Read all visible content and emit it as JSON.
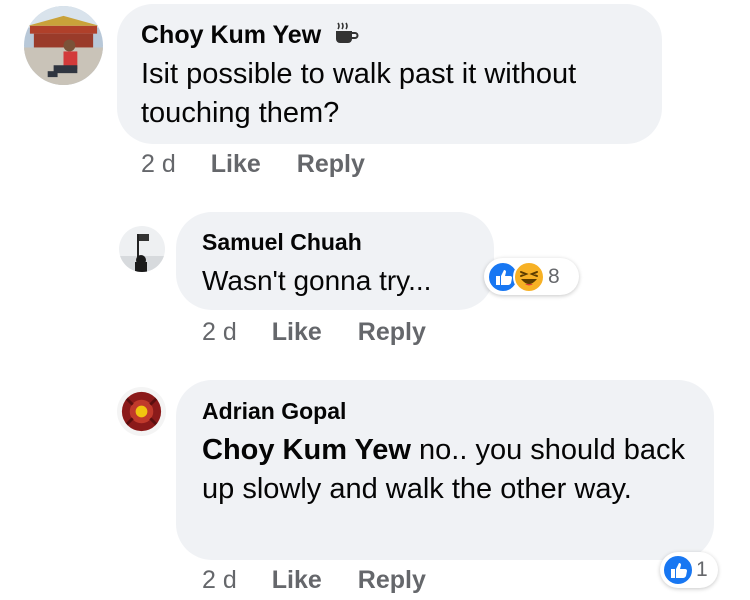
{
  "comments": [
    {
      "author": "Choy Kum Yew",
      "badge_icon": "coffee-cup-icon",
      "text": "Isit possible to walk past it without touching them?",
      "time": "2 d",
      "like_label": "Like",
      "reply_label": "Reply"
    },
    {
      "author": "Samuel Chuah",
      "text": "Wasn't gonna try...",
      "time": "2 d",
      "like_label": "Like",
      "reply_label": "Reply",
      "reactions": {
        "icons": [
          "like-reaction-icon",
          "haha-reaction-icon"
        ],
        "count": "8"
      }
    },
    {
      "author": "Adrian Gopal",
      "mention": "Choy Kum Yew",
      "text": " no.. you should back up slowly and walk the other way.",
      "time": "2 d",
      "like_label": "Like",
      "reply_label": "Reply",
      "reactions": {
        "icons": [
          "like-reaction-icon"
        ],
        "count": "1"
      }
    }
  ],
  "colors": {
    "bubble": "#f0f2f5",
    "meta_text": "#65676b",
    "like_blue": "#1877f2",
    "haha_yellow": "#f7b125"
  }
}
